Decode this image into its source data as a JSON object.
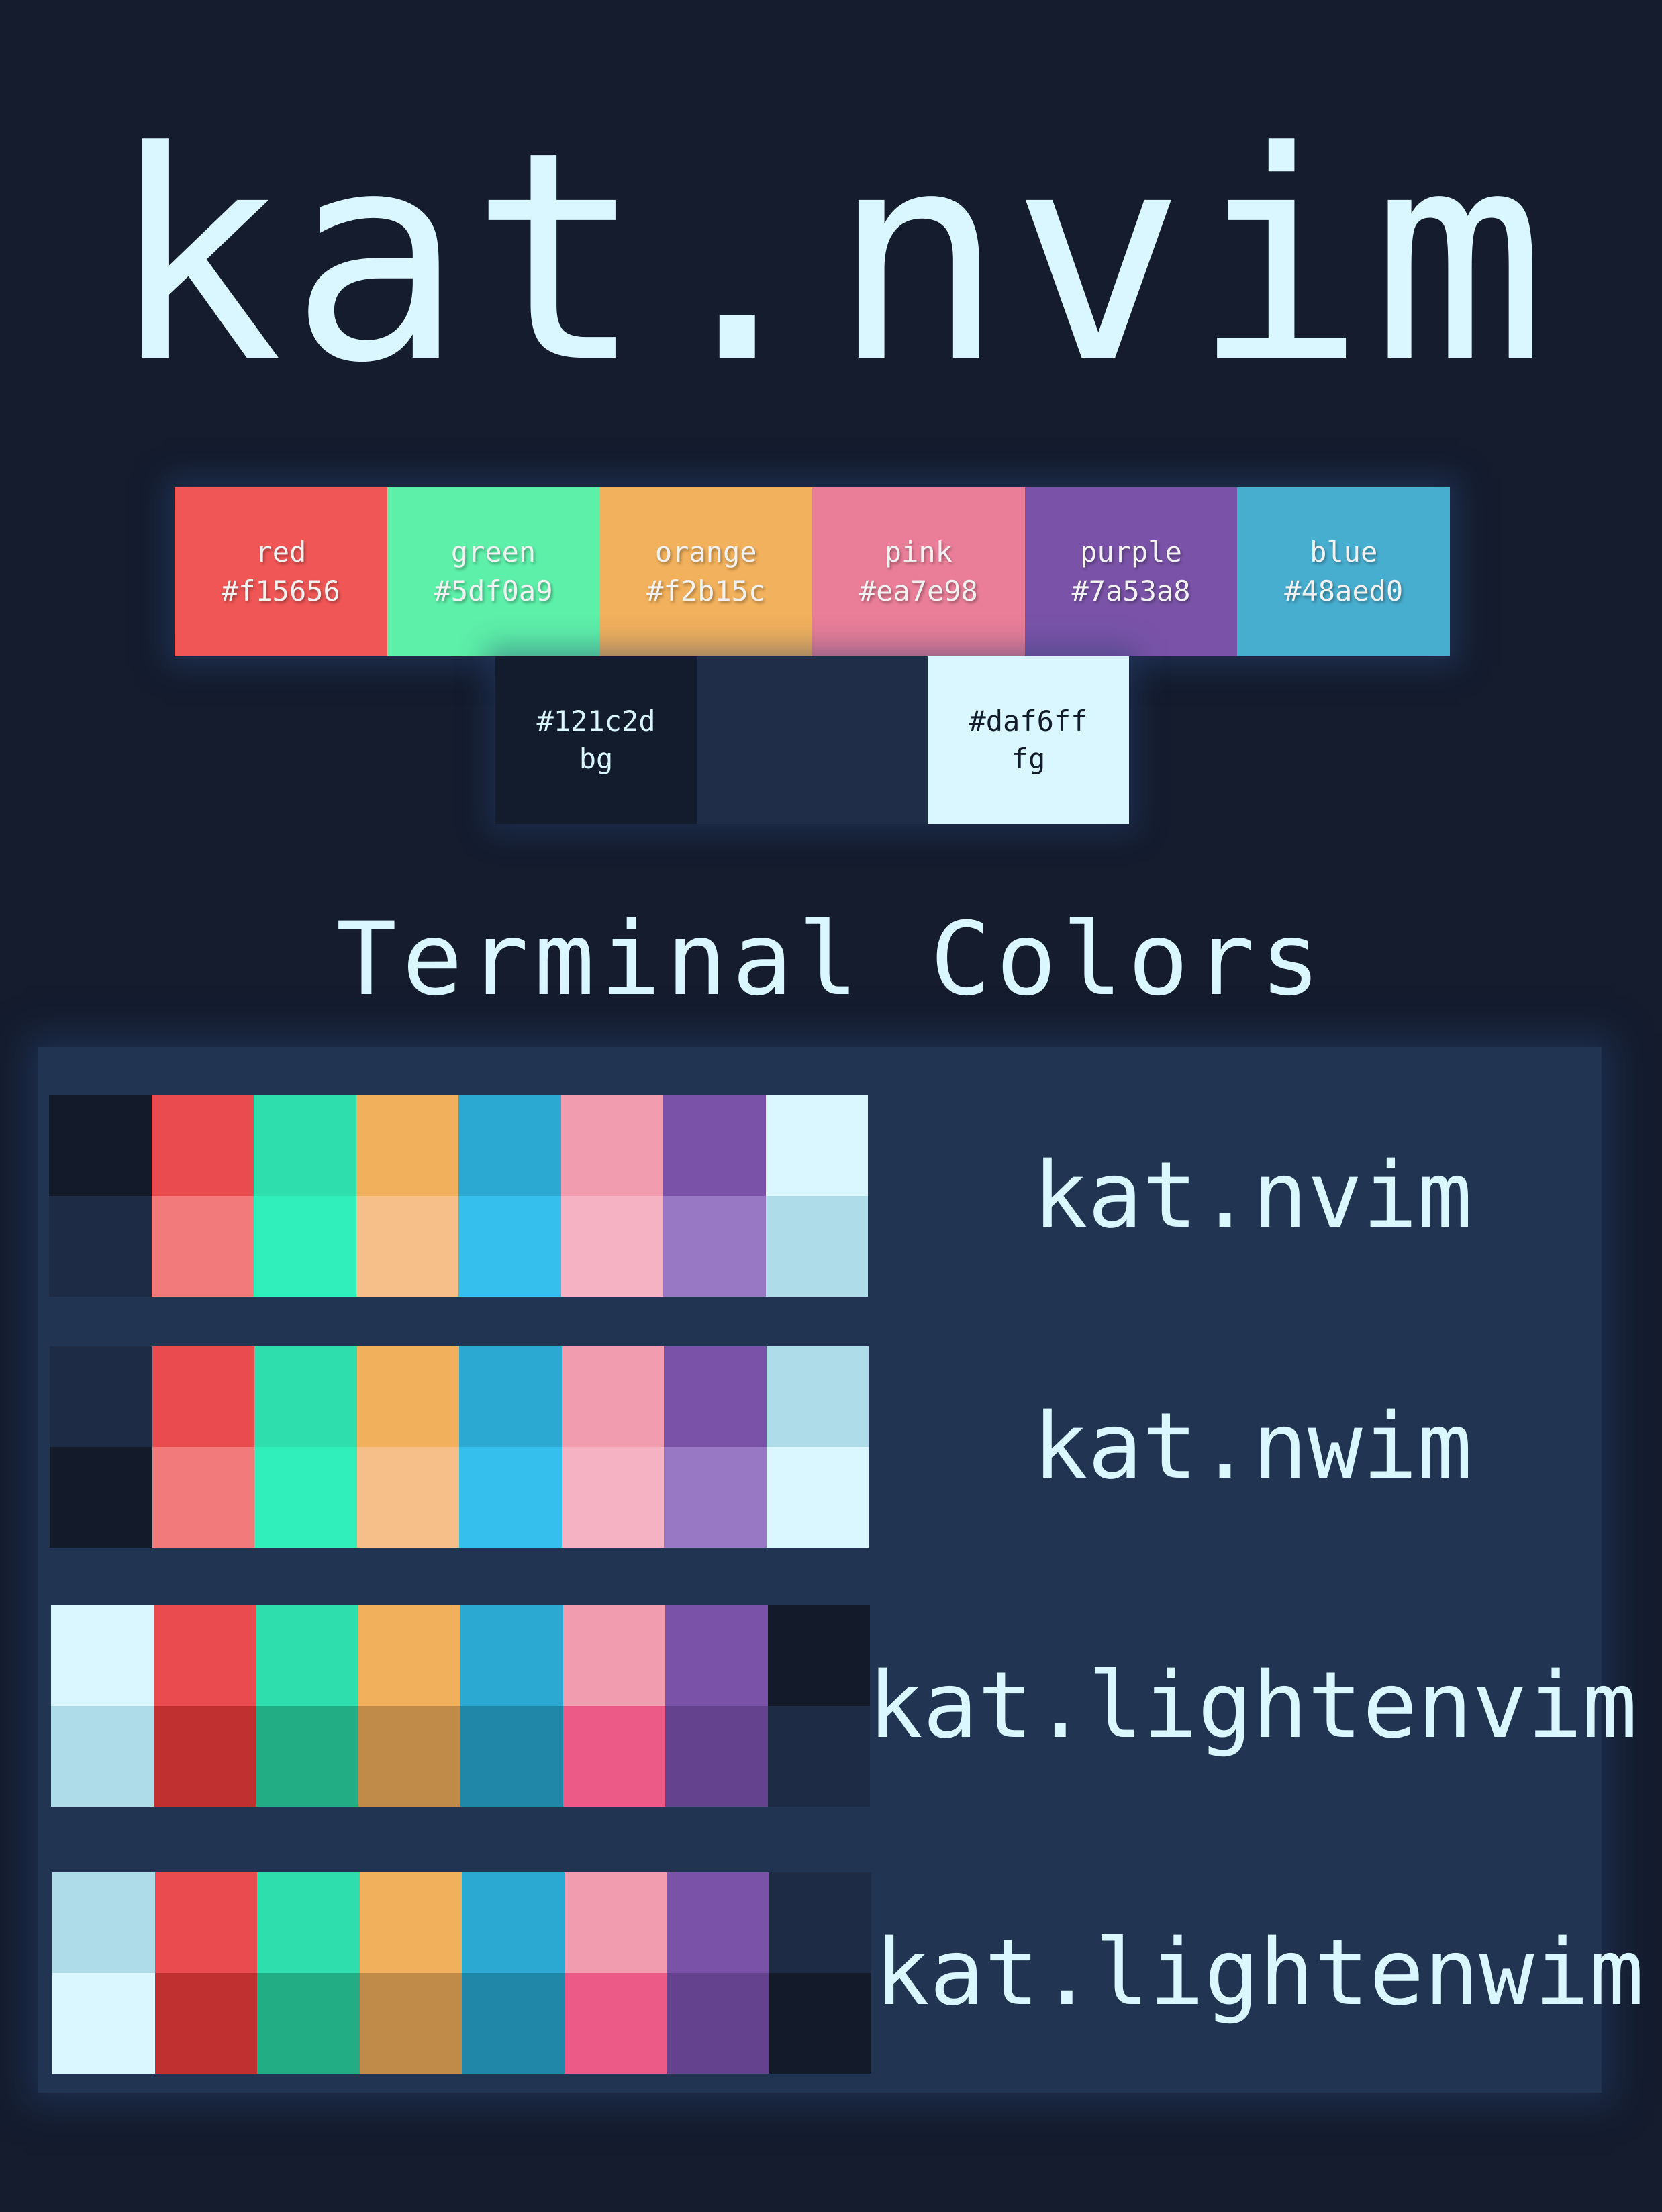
{
  "title": "kat.nvim",
  "palette": [
    {
      "name": "red",
      "hex": "#f15656",
      "color": "#f15656"
    },
    {
      "name": "green",
      "hex": "#5df0a9",
      "color": "#5df0a9"
    },
    {
      "name": "orange",
      "hex": "#f2b15c",
      "color": "#f2b15c"
    },
    {
      "name": "pink",
      "hex": "#ea7e98",
      "color": "#ea7e98"
    },
    {
      "name": "purple",
      "hex": "#7a53a8",
      "color": "#7a53a8"
    },
    {
      "name": "blue",
      "hex": "#48aed0",
      "color": "#48aed0"
    }
  ],
  "base": {
    "bg": {
      "hex": "#121c2d",
      "label": "bg",
      "color": "#121c2d"
    },
    "fg": {
      "hex": "#daf6ff",
      "label": "fg",
      "color": "#daf6ff"
    }
  },
  "terminal_heading": "Terminal Colors",
  "schemes": [
    {
      "name": "kat.nvim",
      "normal": [
        "#131b2b",
        "#ea4b4f",
        "#2edfad",
        "#f1b05c",
        "#2ba9d3",
        "#f19caf",
        "#7a53a8",
        "#daf6ff"
      ],
      "bright": [
        "#1e2b44",
        "#f27a7a",
        "#31efbb",
        "#f6bf8a",
        "#34bfec",
        "#f5b2c2",
        "#9877c4",
        "#aedde9"
      ]
    },
    {
      "name": "kat.nwim",
      "normal": [
        "#1e2b44",
        "#ea4b4f",
        "#2edfad",
        "#f1b05c",
        "#2ba9d3",
        "#f19caf",
        "#7a53a8",
        "#aedde9"
      ],
      "bright": [
        "#131b2b",
        "#f27a7a",
        "#31efbb",
        "#f6bf8a",
        "#34bfec",
        "#f5b2c2",
        "#9877c4",
        "#daf6ff"
      ]
    },
    {
      "name": "kat.lightenvim",
      "normal": [
        "#daf6ff",
        "#ea4b4f",
        "#2edfad",
        "#f1b05c",
        "#2ba9d3",
        "#f19caf",
        "#7a53a8",
        "#131b2b"
      ],
      "bright": [
        "#aedde9",
        "#c03031",
        "#22ad85",
        "#c08a48",
        "#2087a9",
        "#ec5a87",
        "#64428d",
        "#1e2b44"
      ]
    },
    {
      "name": "kat.lightenwim",
      "normal": [
        "#aedde9",
        "#ea4b4f",
        "#2edfad",
        "#f1b05c",
        "#2ba9d3",
        "#f19caf",
        "#7a53a8",
        "#1e2b44"
      ],
      "bright": [
        "#daf6ff",
        "#c03031",
        "#22ad85",
        "#c08a48",
        "#2087a9",
        "#ec5a87",
        "#64428d",
        "#131b2b"
      ]
    }
  ]
}
